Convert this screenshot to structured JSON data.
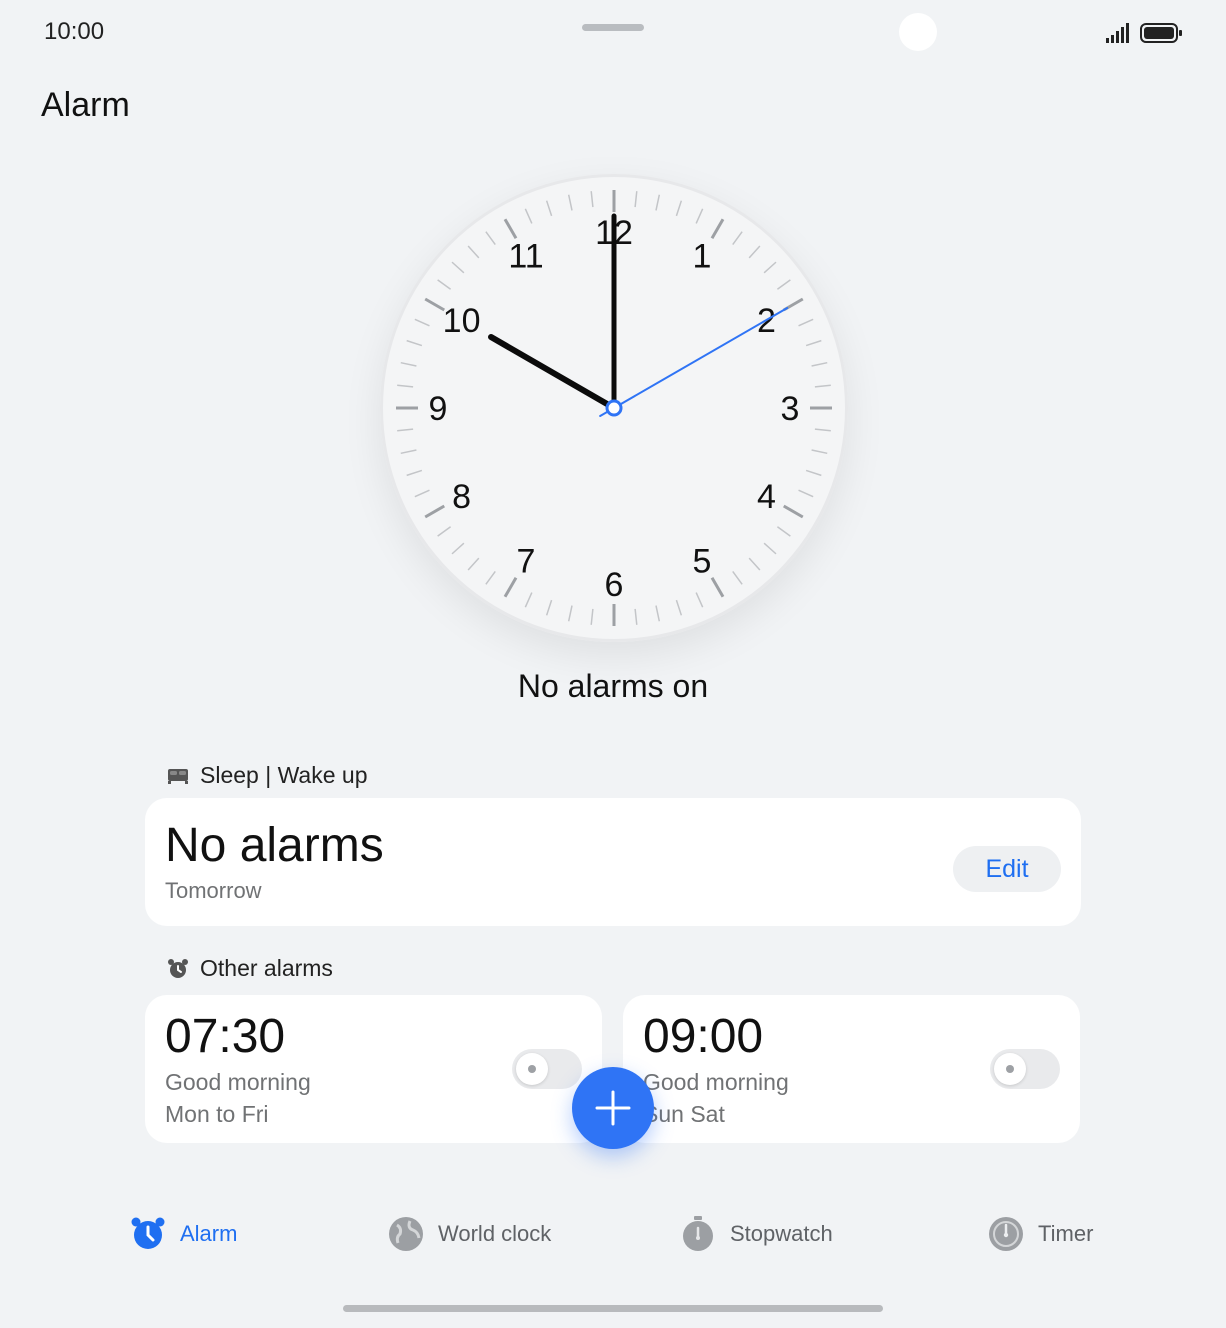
{
  "status_bar": {
    "time": "10:00"
  },
  "header": {
    "title": "Alarm"
  },
  "clock": {
    "numerals": [
      "12",
      "1",
      "2",
      "3",
      "4",
      "5",
      "6",
      "7",
      "8",
      "9",
      "10",
      "11"
    ],
    "time_shown": "10:00",
    "status_text": "No alarms on"
  },
  "sleep_section": {
    "label": "Sleep | Wake up",
    "card_title": "No alarms",
    "card_subtitle": "Tomorrow",
    "edit_label": "Edit"
  },
  "other_section": {
    "label": "Other alarms",
    "alarms": [
      {
        "time": "07:30",
        "name": "Good morning",
        "days": "Mon to Fri",
        "enabled": false
      },
      {
        "time": "09:00",
        "name": "Good morning",
        "days": "Sun Sat",
        "enabled": false
      }
    ]
  },
  "tabs": [
    {
      "label": "Alarm",
      "icon": "alarm-icon",
      "active": true
    },
    {
      "label": "World clock",
      "icon": "globe-icon",
      "active": false
    },
    {
      "label": "Stopwatch",
      "icon": "stopwatch-icon",
      "active": false
    },
    {
      "label": "Timer",
      "icon": "timer-icon",
      "active": false
    }
  ],
  "colors": {
    "accent": "#1f6ff1",
    "second_hand": "#2f74f5",
    "background": "#f1f3f5"
  }
}
